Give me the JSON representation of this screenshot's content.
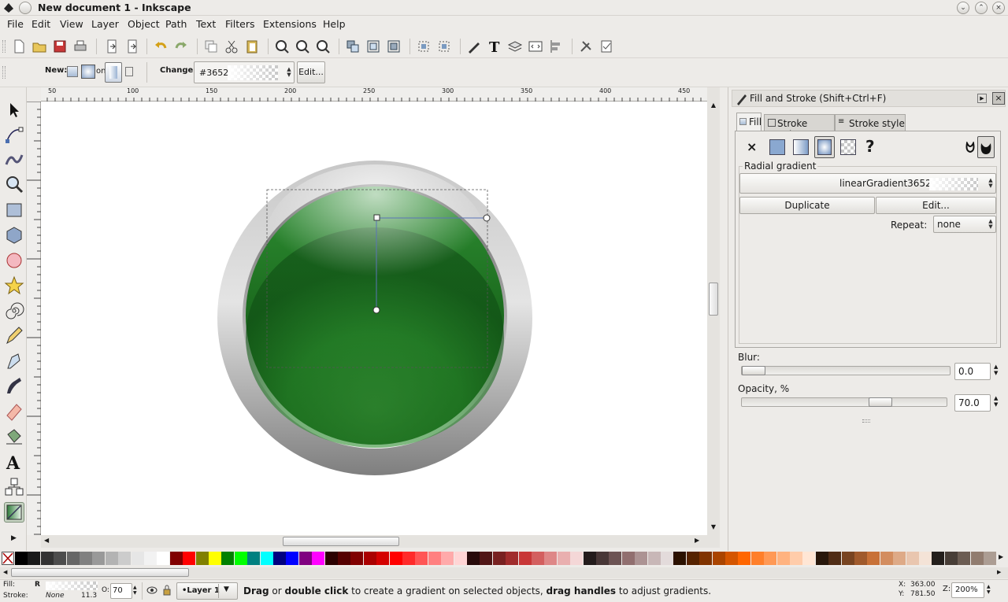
{
  "window": {
    "title": "New document 1 - Inkscape"
  },
  "menu": [
    "File",
    "Edit",
    "View",
    "Layer",
    "Object",
    "Path",
    "Text",
    "Filters",
    "Extensions",
    "Help"
  ],
  "toolbar": {
    "icons": [
      "new-document-icon",
      "open-folder-icon",
      "save-icon",
      "print-icon",
      "import-icon",
      "export-icon",
      "undo-icon",
      "redo-icon",
      "duplicate-icon",
      "cut-icon",
      "paste-icon",
      "zoom-selection-icon",
      "zoom-drawing-icon",
      "zoom-page-icon",
      "group-icon",
      "ungroup-icon",
      "clone-icon",
      "align-icon",
      "node-icon",
      "pen-icon",
      "text-tool-icon",
      "layers-icon",
      "xml-editor-icon",
      "align-distribute-icon",
      "preferences-icon",
      "document-properties-icon"
    ]
  },
  "gradient_toolbar": {
    "new_label": "New:",
    "on_label": "on",
    "change_label": "Change:",
    "gradient_id": "#3652",
    "edit_label": "Edit..."
  },
  "ruler": {
    "top_ticks": [
      "50",
      "100",
      "150",
      "200",
      "250",
      "300",
      "350",
      "400",
      "450"
    ]
  },
  "panel": {
    "title": "Fill and Stroke (Shift+Ctrl+F)",
    "tabs": [
      "Fill",
      "Stroke paint",
      "Stroke style"
    ],
    "gradient_section": "Radial gradient",
    "gradient_name": "linearGradient3652",
    "duplicate_label": "Duplicate",
    "edit_label": "Edit...",
    "repeat_label": "Repeat:",
    "repeat_value": "none",
    "blur_label": "Blur:",
    "blur_value": "0.0",
    "blur_level": 0,
    "opacity_label": "Opacity, %",
    "opacity_value": "70.0",
    "opacity_level": 0.7
  },
  "palette_colors": [
    "#000000",
    "#1a1a1a",
    "#333333",
    "#4d4d4d",
    "#666666",
    "#808080",
    "#999999",
    "#b3b3b3",
    "#cccccc",
    "#e6e6e6",
    "#f2f2f2",
    "#ffffff",
    "#800000",
    "#ff0000",
    "#808000",
    "#ffff00",
    "#008000",
    "#00ff00",
    "#008080",
    "#00ffff",
    "#000080",
    "#0000ff",
    "#800080",
    "#ff00ff",
    "#2b0000",
    "#550000",
    "#800000",
    "#aa0000",
    "#d40000",
    "#ff0000",
    "#ff2a2a",
    "#ff5555",
    "#ff8080",
    "#ffaaaa",
    "#ffd5d5",
    "#280b0b",
    "#501616",
    "#782121",
    "#a02c2c",
    "#c83737",
    "#d35f5f",
    "#de8787",
    "#e9afaf",
    "#f4d7d7",
    "#241c1c",
    "#483737",
    "#6c5353",
    "#916f6f",
    "#ac9393",
    "#c8b7b7",
    "#e3dbdb",
    "#2b1100",
    "#552200",
    "#803300",
    "#aa4400",
    "#d45500",
    "#ff6600",
    "#ff7f2a",
    "#ff9955",
    "#ffb380",
    "#ffccaa",
    "#ffe6d5",
    "#28170b",
    "#502d16",
    "#784421",
    "#a05a2c",
    "#c87137",
    "#d38d5f",
    "#deaa87",
    "#e9c6af",
    "#f4e3d7",
    "#241f1c",
    "#483e37",
    "#6c5d53",
    "#917c6f",
    "#ac9d93"
  ],
  "status": {
    "fill_label": "Fill:",
    "fill_value": "R",
    "stroke_label": "Stroke:",
    "stroke_value": "None",
    "stroke_width": "11.3",
    "opacity_short": "O:",
    "opacity_value": "70",
    "layer": "•Layer 1",
    "message_parts": [
      "Drag",
      " or ",
      "double click",
      " to create a gradient on selected objects, ",
      "drag handles",
      " to adjust gradients."
    ],
    "x_label": "X:",
    "x_value": "363.00",
    "y_label": "Y:",
    "y_value": "781.50",
    "zoom_label": "Z:",
    "zoom_value": "200%"
  }
}
